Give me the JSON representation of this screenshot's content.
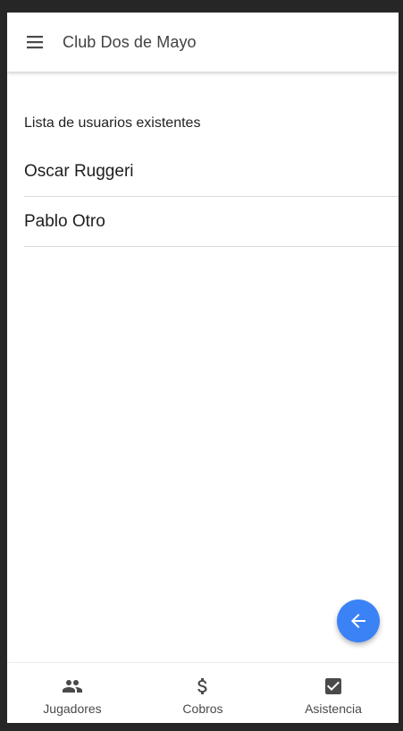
{
  "app_bar": {
    "title": "Club Dos de Mayo",
    "menu_icon": "menu-icon"
  },
  "main": {
    "section_label": "Lista de usuarios existentes",
    "users": [
      {
        "name": "Oscar Ruggeri"
      },
      {
        "name": "Pablo Otro"
      }
    ]
  },
  "fab": {
    "icon": "arrow-left-icon",
    "color": "#3b82f6"
  },
  "bottom_nav": {
    "items": [
      {
        "label": "Jugadores",
        "icon": "people-icon"
      },
      {
        "label": "Cobros",
        "icon": "dollar-icon"
      },
      {
        "label": "Asistencia",
        "icon": "checkbox-icon"
      }
    ]
  },
  "colors": {
    "surround": "#262626",
    "surface": "#ffffff",
    "accent": "#3b82f6",
    "icon": "#4a4a4a"
  }
}
